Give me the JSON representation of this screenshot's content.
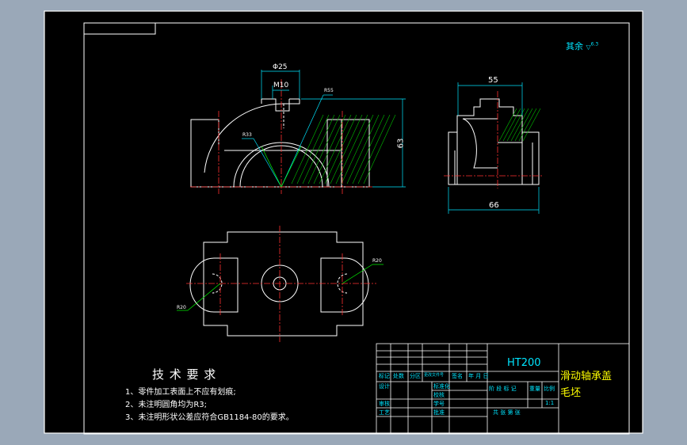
{
  "roughness": {
    "label": "其余",
    "value": "6.3"
  },
  "dims": {
    "phi25": "Φ25",
    "m10": "M10",
    "r55": "R55",
    "r33": "R33",
    "h63": "63",
    "w55": "55",
    "w66": "66",
    "r20_left": "R20",
    "r20_right": "R20"
  },
  "tech_req": {
    "title": "技 术 要 求",
    "items": [
      "1、零件加工表面上不应有划痕;",
      "2、未注明圆角均为R3;",
      "3、未注明形状公差应符合GB1184-80的要求。"
    ]
  },
  "title_block": {
    "material": "HT200",
    "part_name": "滑动轴承盖",
    "part_sub": "毛坯",
    "row_labels": [
      "标记",
      "处数",
      "分区",
      "更改文件号",
      "签名",
      "年 月 日"
    ],
    "designer": "设计",
    "standard": "标准化",
    "stage": "阶 段 标 记",
    "weight": "重量",
    "scale_label": "比例",
    "scale": "1:1",
    "review": "审核",
    "craft": "工艺",
    "approve": "批准",
    "sheet": "共  张 第  张",
    "check": "校核",
    "number": "学号"
  }
}
